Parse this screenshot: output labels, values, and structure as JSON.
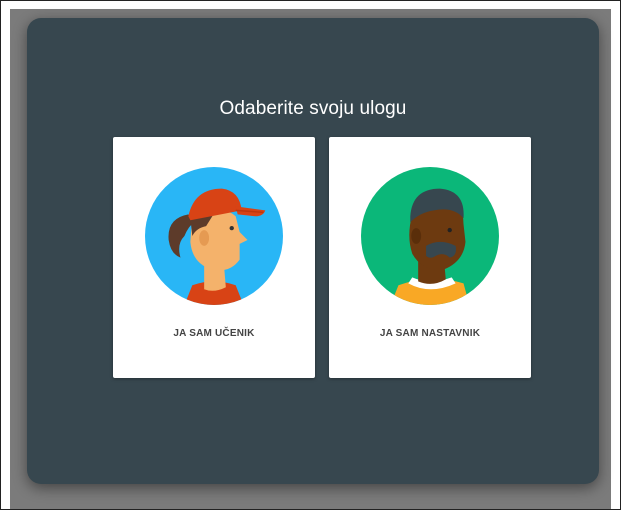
{
  "dialog": {
    "title": "Odaberite svoju ulogu",
    "roles": [
      {
        "label": "JA SAM UČENIK",
        "avatar_icon": "student-avatar-icon",
        "avatar_bg": "#29b6f6"
      },
      {
        "label": "JA SAM NASTAVNIK",
        "avatar_icon": "teacher-avatar-icon",
        "avatar_bg": "#0bb779"
      }
    ]
  },
  "colors": {
    "dialog_bg": "#37474f",
    "backdrop": "#7b7b7b",
    "card_bg": "#ffffff"
  }
}
